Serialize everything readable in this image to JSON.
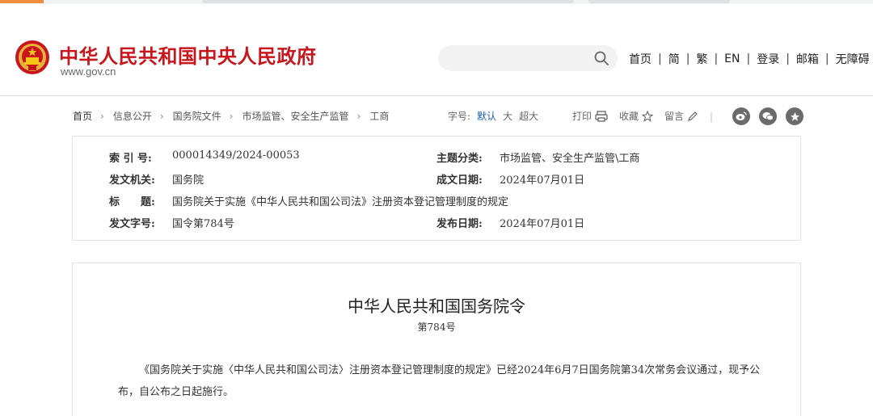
{
  "header": {
    "site_title": "中华人民共和国中央人民政府",
    "site_url": "www.gov.cn",
    "search_placeholder": "",
    "nav": [
      "首页",
      "简",
      "繁",
      "EN",
      "登录",
      "邮箱",
      "无障碍"
    ],
    "nav_separator": "|"
  },
  "breadcrumb": {
    "items": [
      "首页",
      "信息公开",
      "国务院文件",
      "市场监管、安全生产监管",
      "工商"
    ],
    "arrow": "›"
  },
  "font_size": {
    "label": "字号:",
    "options": [
      "默认",
      "大",
      "超大"
    ],
    "selected": "默认"
  },
  "tools": {
    "print": "打印",
    "favorite": "收藏",
    "comment": "留言",
    "divider": "|"
  },
  "share": [
    "weibo-icon",
    "wechat-icon",
    "qzone-icon"
  ],
  "doc_info": {
    "index_label": "索 引 号:",
    "index_value": "000014349/2024-00053",
    "category_label": "主题分类:",
    "category_value": "市场监管、安全生产监管\\工商",
    "issuer_label": "发文机关:",
    "issuer_value": "国务院",
    "written_label": "成文日期:",
    "written_value": "2024年07月01日",
    "title_label": "标　　题:",
    "title_value": "国务院关于实施《中华人民共和国公司法》注册资本登记管理制度的规定",
    "docno_label": "发文字号:",
    "docno_value": "国令第784号",
    "published_label": "发布日期:",
    "published_value": "2024年07月01日"
  },
  "document": {
    "title": "中华人民共和国国务院令",
    "number": "第784号",
    "body": "《国务院关于实施〈中华人民共和国公司法〉注册资本登记管理制度的规定》已经2024年6月7日国务院第34次常务会议通过，现予公布，自公布之日起施行。"
  },
  "colors": {
    "brand_red": "#c8161d",
    "link_blue": "#1b5da9",
    "border": "#e2e2e2"
  }
}
